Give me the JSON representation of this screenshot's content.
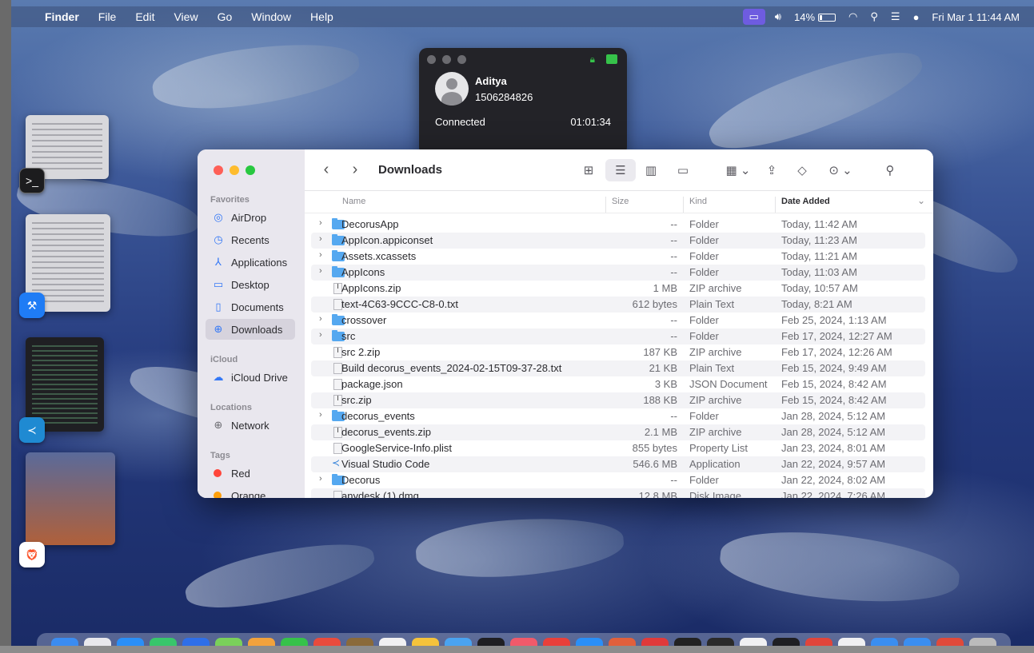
{
  "menubar": {
    "app_name": "Finder",
    "menus": [
      "File",
      "Edit",
      "View",
      "Go",
      "Window",
      "Help"
    ],
    "battery_percent": "14%",
    "datetime": "Fri Mar 1  11:44 AM"
  },
  "call": {
    "contact_name": "Aditya",
    "phone_number": "1506284826",
    "status": "Connected",
    "duration": "01:01:34"
  },
  "finder": {
    "title": "Downloads",
    "sidebar": {
      "favorites_header": "Favorites",
      "favorites": [
        {
          "label": "AirDrop",
          "icon": "airdrop-icon"
        },
        {
          "label": "Recents",
          "icon": "clock-icon"
        },
        {
          "label": "Applications",
          "icon": "applications-icon"
        },
        {
          "label": "Desktop",
          "icon": "desktop-icon"
        },
        {
          "label": "Documents",
          "icon": "document-icon"
        },
        {
          "label": "Downloads",
          "icon": "download-icon",
          "active": true
        }
      ],
      "icloud_header": "iCloud",
      "icloud": [
        {
          "label": "iCloud Drive",
          "icon": "cloud-icon"
        }
      ],
      "locations_header": "Locations",
      "locations": [
        {
          "label": "Network",
          "icon": "globe-icon"
        }
      ],
      "tags_header": "Tags",
      "tags": [
        {
          "label": "Red",
          "color": "#ff453a"
        },
        {
          "label": "Orange",
          "color": "#ff9f0a"
        }
      ]
    },
    "columns": {
      "name": "Name",
      "size": "Size",
      "kind": "Kind",
      "date_added": "Date Added"
    },
    "files": [
      {
        "name": "DecorusApp",
        "size": "--",
        "kind": "Folder",
        "date": "Today, 11:42 AM",
        "type": "folder"
      },
      {
        "name": "AppIcon.appiconset",
        "size": "--",
        "kind": "Folder",
        "date": "Today, 11:23 AM",
        "type": "folder"
      },
      {
        "name": "Assets.xcassets",
        "size": "--",
        "kind": "Folder",
        "date": "Today, 11:21 AM",
        "type": "folder"
      },
      {
        "name": "AppIcons",
        "size": "--",
        "kind": "Folder",
        "date": "Today, 11:03 AM",
        "type": "folder"
      },
      {
        "name": "AppIcons.zip",
        "size": "1 MB",
        "kind": "ZIP archive",
        "date": "Today, 10:57 AM",
        "type": "zip"
      },
      {
        "name": "text-4C63-9CCC-C8-0.txt",
        "size": "612 bytes",
        "kind": "Plain Text",
        "date": "Today, 8:21 AM",
        "type": "doc"
      },
      {
        "name": "crossover",
        "size": "--",
        "kind": "Folder",
        "date": "Feb 25, 2024, 1:13 AM",
        "type": "folder"
      },
      {
        "name": "src",
        "size": "--",
        "kind": "Folder",
        "date": "Feb 17, 2024, 12:27 AM",
        "type": "folder"
      },
      {
        "name": "src 2.zip",
        "size": "187 KB",
        "kind": "ZIP archive",
        "date": "Feb 17, 2024, 12:26 AM",
        "type": "zip"
      },
      {
        "name": "Build decorus_events_2024-02-15T09-37-28.txt",
        "size": "21 KB",
        "kind": "Plain Text",
        "date": "Feb 15, 2024, 9:49 AM",
        "type": "doc"
      },
      {
        "name": "package.json",
        "size": "3 KB",
        "kind": "JSON Document",
        "date": "Feb 15, 2024, 8:42 AM",
        "type": "doc"
      },
      {
        "name": "src.zip",
        "size": "188 KB",
        "kind": "ZIP archive",
        "date": "Feb 15, 2024, 8:42 AM",
        "type": "zip"
      },
      {
        "name": "decorus_events",
        "size": "--",
        "kind": "Folder",
        "date": "Jan 28, 2024, 5:12 AM",
        "type": "folder"
      },
      {
        "name": "decorus_events.zip",
        "size": "2.1 MB",
        "kind": "ZIP archive",
        "date": "Jan 28, 2024, 5:12 AM",
        "type": "zip"
      },
      {
        "name": "GoogleService-Info.plist",
        "size": "855 bytes",
        "kind": "Property List",
        "date": "Jan 23, 2024, 8:01 AM",
        "type": "doc"
      },
      {
        "name": "Visual Studio Code",
        "size": "546.6 MB",
        "kind": "Application",
        "date": "Jan 22, 2024, 9:57 AM",
        "type": "app"
      },
      {
        "name": "Decorus",
        "size": "--",
        "kind": "Folder",
        "date": "Jan 22, 2024, 8:02 AM",
        "type": "folder"
      },
      {
        "name": "anydesk (1).dmg",
        "size": "12.8 MB",
        "kind": "Disk Image",
        "date": "Jan 22, 2024, 7:26 AM",
        "type": "doc"
      }
    ]
  }
}
